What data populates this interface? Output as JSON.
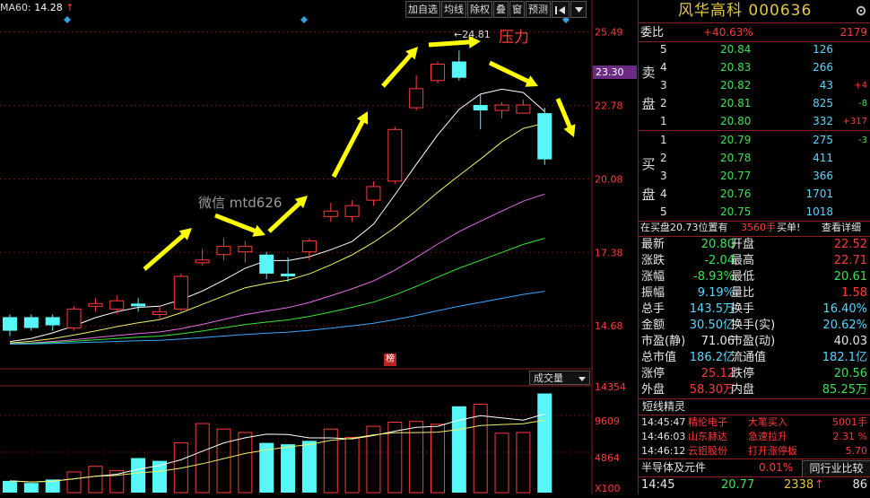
{
  "chart_header": {
    "ma_label": "MA60:",
    "ma_value": "14.28",
    "ma_arrow": "↑"
  },
  "toolbar": [
    "加自选",
    "均线",
    "除权",
    "叠",
    "窗",
    "预测"
  ],
  "toolbar_icons": [
    "panel-toggle-icon",
    "dropdown-arrow-icon"
  ],
  "price_axis": [
    "25.49",
    "22.78",
    "20.08",
    "17.38",
    "14.68"
  ],
  "current_price_tag": "23.30",
  "annotations": {
    "peak": "24.81",
    "pressure": "压力",
    "watermark": "微信 mtd626",
    "rank_badge": "榜"
  },
  "volume_panel": {
    "label": "成交量",
    "axis": [
      "14354",
      "9609",
      "4864"
    ],
    "multiplier": "X100"
  },
  "chart_data": {
    "type": "candlestick",
    "candles": [
      {
        "o": 15.0,
        "c": 14.5,
        "h": 15.1,
        "l": 14.3,
        "dir": "down"
      },
      {
        "o": 15.0,
        "c": 14.6,
        "h": 15.1,
        "l": 14.5,
        "dir": "down"
      },
      {
        "o": 14.7,
        "c": 15.0,
        "h": 15.1,
        "l": 14.5,
        "dir": "down"
      },
      {
        "o": 14.6,
        "c": 15.3,
        "h": 15.4,
        "l": 14.5,
        "dir": "up"
      },
      {
        "o": 15.4,
        "c": 15.5,
        "h": 15.7,
        "l": 15.2,
        "dir": "up"
      },
      {
        "o": 15.3,
        "c": 15.6,
        "h": 15.8,
        "l": 15.1,
        "dir": "up"
      },
      {
        "o": 15.5,
        "c": 15.4,
        "h": 15.7,
        "l": 15.2,
        "dir": "down"
      },
      {
        "o": 15.1,
        "c": 15.2,
        "h": 15.4,
        "l": 14.9,
        "dir": "up"
      },
      {
        "o": 15.3,
        "c": 16.5,
        "h": 16.6,
        "l": 15.2,
        "dir": "up"
      },
      {
        "o": 17.0,
        "c": 17.1,
        "h": 17.5,
        "l": 16.9,
        "dir": "up"
      },
      {
        "o": 17.3,
        "c": 17.6,
        "h": 17.9,
        "l": 17.1,
        "dir": "up"
      },
      {
        "o": 17.4,
        "c": 17.6,
        "h": 17.8,
        "l": 17.0,
        "dir": "up"
      },
      {
        "o": 17.3,
        "c": 16.6,
        "h": 17.4,
        "l": 16.4,
        "dir": "down"
      },
      {
        "o": 16.6,
        "c": 16.5,
        "h": 17.2,
        "l": 16.3,
        "dir": "down"
      },
      {
        "o": 17.4,
        "c": 17.8,
        "h": 17.9,
        "l": 17.1,
        "dir": "up"
      },
      {
        "o": 18.7,
        "c": 18.9,
        "h": 19.2,
        "l": 18.5,
        "dir": "up"
      },
      {
        "o": 18.7,
        "c": 19.1,
        "h": 19.3,
        "l": 18.5,
        "dir": "up"
      },
      {
        "o": 19.3,
        "c": 19.8,
        "h": 20.0,
        "l": 19.1,
        "dir": "up"
      },
      {
        "o": 20.0,
        "c": 21.9,
        "h": 22.0,
        "l": 19.9,
        "dir": "up"
      },
      {
        "o": 22.7,
        "c": 23.4,
        "h": 23.9,
        "l": 22.6,
        "dir": "up"
      },
      {
        "o": 23.7,
        "c": 24.3,
        "h": 24.4,
        "l": 23.6,
        "dir": "up"
      },
      {
        "o": 24.4,
        "c": 23.8,
        "h": 24.8,
        "l": 23.7,
        "dir": "down"
      },
      {
        "o": 22.8,
        "c": 22.6,
        "h": 23.2,
        "l": 21.9,
        "dir": "down"
      },
      {
        "o": 22.6,
        "c": 22.8,
        "h": 22.9,
        "l": 22.3,
        "dir": "up"
      },
      {
        "o": 22.5,
        "c": 22.8,
        "h": 23.0,
        "l": 22.5,
        "dir": "up"
      },
      {
        "o": 22.5,
        "c": 20.8,
        "h": 22.7,
        "l": 20.6,
        "dir": "down"
      }
    ],
    "volumes": [
      {
        "v": 1700,
        "dir": "down"
      },
      {
        "v": 1400,
        "dir": "down"
      },
      {
        "v": 1900,
        "dir": "down"
      },
      {
        "v": 3000,
        "dir": "up"
      },
      {
        "v": 3800,
        "dir": "up"
      },
      {
        "v": 3200,
        "dir": "up"
      },
      {
        "v": 5000,
        "dir": "down"
      },
      {
        "v": 4600,
        "dir": "down"
      },
      {
        "v": 7200,
        "dir": "up"
      },
      {
        "v": 10000,
        "dir": "up"
      },
      {
        "v": 9200,
        "dir": "up"
      },
      {
        "v": 8700,
        "dir": "up"
      },
      {
        "v": 7200,
        "dir": "down"
      },
      {
        "v": 7000,
        "dir": "down"
      },
      {
        "v": 7500,
        "dir": "down"
      },
      {
        "v": 9200,
        "dir": "up"
      },
      {
        "v": 8000,
        "dir": "up"
      },
      {
        "v": 9600,
        "dir": "up"
      },
      {
        "v": 10200,
        "dir": "up"
      },
      {
        "v": 10300,
        "dir": "up"
      },
      {
        "v": 9900,
        "dir": "up"
      },
      {
        "v": 12500,
        "dir": "down"
      },
      {
        "v": 12800,
        "dir": "up"
      },
      {
        "v": 8600,
        "dir": "up"
      },
      {
        "v": 8700,
        "dir": "up"
      },
      {
        "v": 14354,
        "dir": "down"
      }
    ],
    "ylim": [
      13.2,
      26.0
    ],
    "vol_ylim": [
      0,
      15200
    ]
  },
  "stock": {
    "name": "风华高科",
    "code": "000636"
  },
  "order_book": {
    "wei_bi_label": "委比",
    "wei_bi_value": "+40.63%",
    "wei_cha": "2179",
    "sell_label_1": "卖",
    "sell_label_2": "盘",
    "buy_label_1": "买",
    "buy_label_2": "盘",
    "asks": [
      {
        "level": "5",
        "price": "20.84",
        "vol": "126",
        "chg": ""
      },
      {
        "level": "4",
        "price": "20.83",
        "vol": "266",
        "chg": ""
      },
      {
        "level": "3",
        "price": "20.82",
        "vol": "43",
        "chg": "+4"
      },
      {
        "level": "2",
        "price": "20.81",
        "vol": "825",
        "chg": "-8"
      },
      {
        "level": "1",
        "price": "20.80",
        "vol": "332",
        "chg": "+317"
      }
    ],
    "bids": [
      {
        "level": "1",
        "price": "20.79",
        "vol": "275",
        "chg": "-3"
      },
      {
        "level": "2",
        "price": "20.78",
        "vol": "411",
        "chg": ""
      },
      {
        "level": "3",
        "price": "20.77",
        "vol": "366",
        "chg": ""
      },
      {
        "level": "4",
        "price": "20.76",
        "vol": "1701",
        "chg": ""
      },
      {
        "level": "5",
        "price": "20.75",
        "vol": "1018",
        "chg": ""
      }
    ]
  },
  "big_order": {
    "text": "在买盘20.73位置有",
    "qty": "3560手",
    "side": "买单!",
    "detail": "查看详细"
  },
  "stats": [
    {
      "l1": "最新",
      "v1": "20.80",
      "c1": "green",
      "l2": "开盘",
      "v2": "22.52",
      "c2": "red"
    },
    {
      "l1": "涨跌",
      "v1": "-2.04",
      "c1": "green",
      "l2": "最高",
      "v2": "22.71",
      "c2": "red"
    },
    {
      "l1": "涨幅",
      "v1": "-8.93%",
      "c1": "green",
      "l2": "最低",
      "v2": "20.61",
      "c2": "green"
    },
    {
      "l1": "振幅",
      "v1": "9.19%",
      "c1": "cyan",
      "l2": "量比",
      "v2": "1.58",
      "c2": "red"
    },
    {
      "l1": "总手",
      "v1": "143.5万",
      "c1": "cyan",
      "l2": "换手",
      "v2": "16.40%",
      "c2": "cyan"
    },
    {
      "l1": "金额",
      "v1": "30.50亿",
      "c1": "cyan",
      "l2": "换手(实)",
      "v2": "20.62%",
      "c2": "cyan"
    },
    {
      "l1": "市盈(静)",
      "v1": "71.06",
      "c1": "white",
      "l2": "市盈(动)",
      "v2": "40.03",
      "c2": "white"
    },
    {
      "l1": "总市值",
      "v1": "186.2亿",
      "c1": "cyan",
      "l2": "流通值",
      "v2": "182.1亿",
      "c2": "cyan"
    },
    {
      "l1": "涨停",
      "v1": "25.12",
      "c1": "red",
      "l2": "跌停",
      "v2": "20.56",
      "c2": "green"
    },
    {
      "l1": "外盘",
      "v1": "58.30万",
      "c1": "red",
      "l2": "内盘",
      "v2": "85.25万",
      "c2": "green"
    }
  ],
  "short_line": {
    "title": "短线精灵",
    "rows": [
      {
        "time": "14:45:47",
        "name": "精伦电子",
        "event": "大笔买入",
        "value": "5001手"
      },
      {
        "time": "14:46:03",
        "name": "山东赫达",
        "event": "急速拉升",
        "value": "2.31 %"
      },
      {
        "time": "14:46:12",
        "name": "云铝股份",
        "event": "打开涨停板",
        "value": "5.70"
      }
    ]
  },
  "sector": {
    "name": "半导体及元件",
    "pct": "0.01%",
    "compare": "同行业比较"
  },
  "last_tick": {
    "time": "14:45",
    "price": "20.77",
    "vol": "2338",
    "arrow": "↑",
    "count": "86"
  },
  "colors": {
    "up": "#ff3b3b",
    "down": "#57f7f7",
    "ma5": "#ffffff",
    "ma10": "#f0f06a",
    "ma20": "#e56ee5",
    "ma30": "#37e637",
    "ma60": "#3aa8ff",
    "arrow": "#ffff00"
  }
}
